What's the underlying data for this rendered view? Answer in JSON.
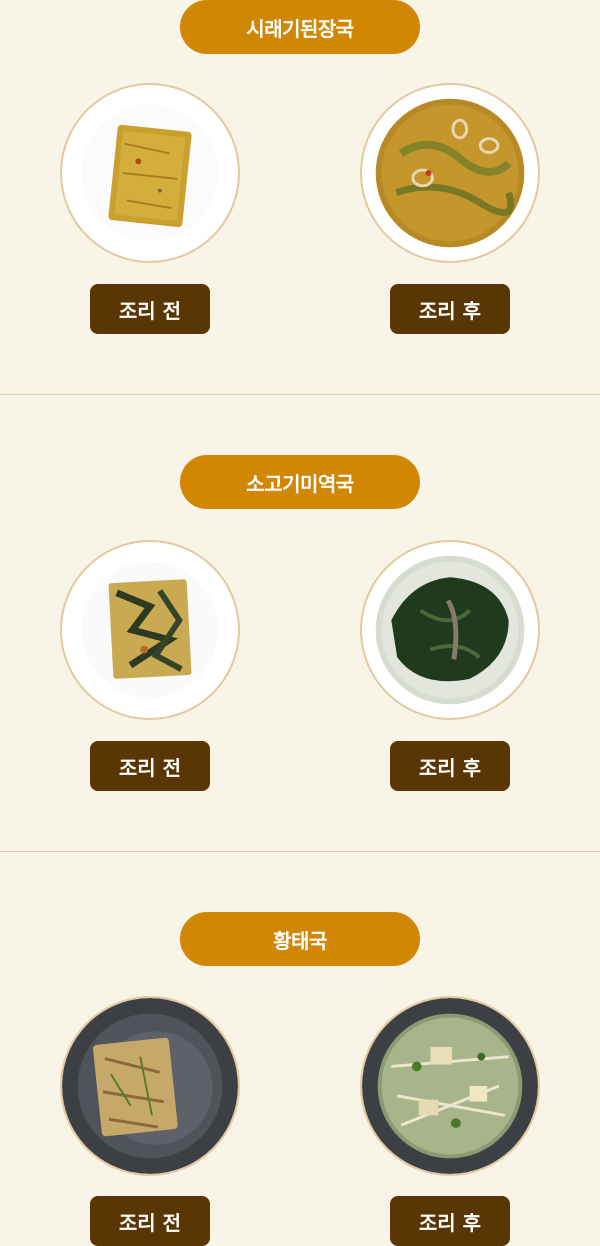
{
  "sections": [
    {
      "title": "시래기된장국",
      "before_label": "조리 전",
      "after_label": "조리 후"
    },
    {
      "title": "소고기미역국",
      "before_label": "조리 전",
      "after_label": "조리 후"
    },
    {
      "title": "황태국",
      "before_label": "조리 전",
      "after_label": "조리 후"
    }
  ],
  "colors": {
    "background": "#f9f4e8",
    "title_pill": "#d18604",
    "label_tag": "#5a3604",
    "divider": "#e6cfa7"
  },
  "images": [
    {
      "name": "siraegi-frozen-block-image",
      "plate": "white"
    },
    {
      "name": "siraegi-soup-image",
      "plate": "white"
    },
    {
      "name": "seaweed-frozen-block-image",
      "plate": "white"
    },
    {
      "name": "seaweed-soup-image",
      "plate": "white"
    },
    {
      "name": "pollock-frozen-block-image",
      "plate": "dark"
    },
    {
      "name": "pollock-soup-image",
      "plate": "dark"
    }
  ]
}
